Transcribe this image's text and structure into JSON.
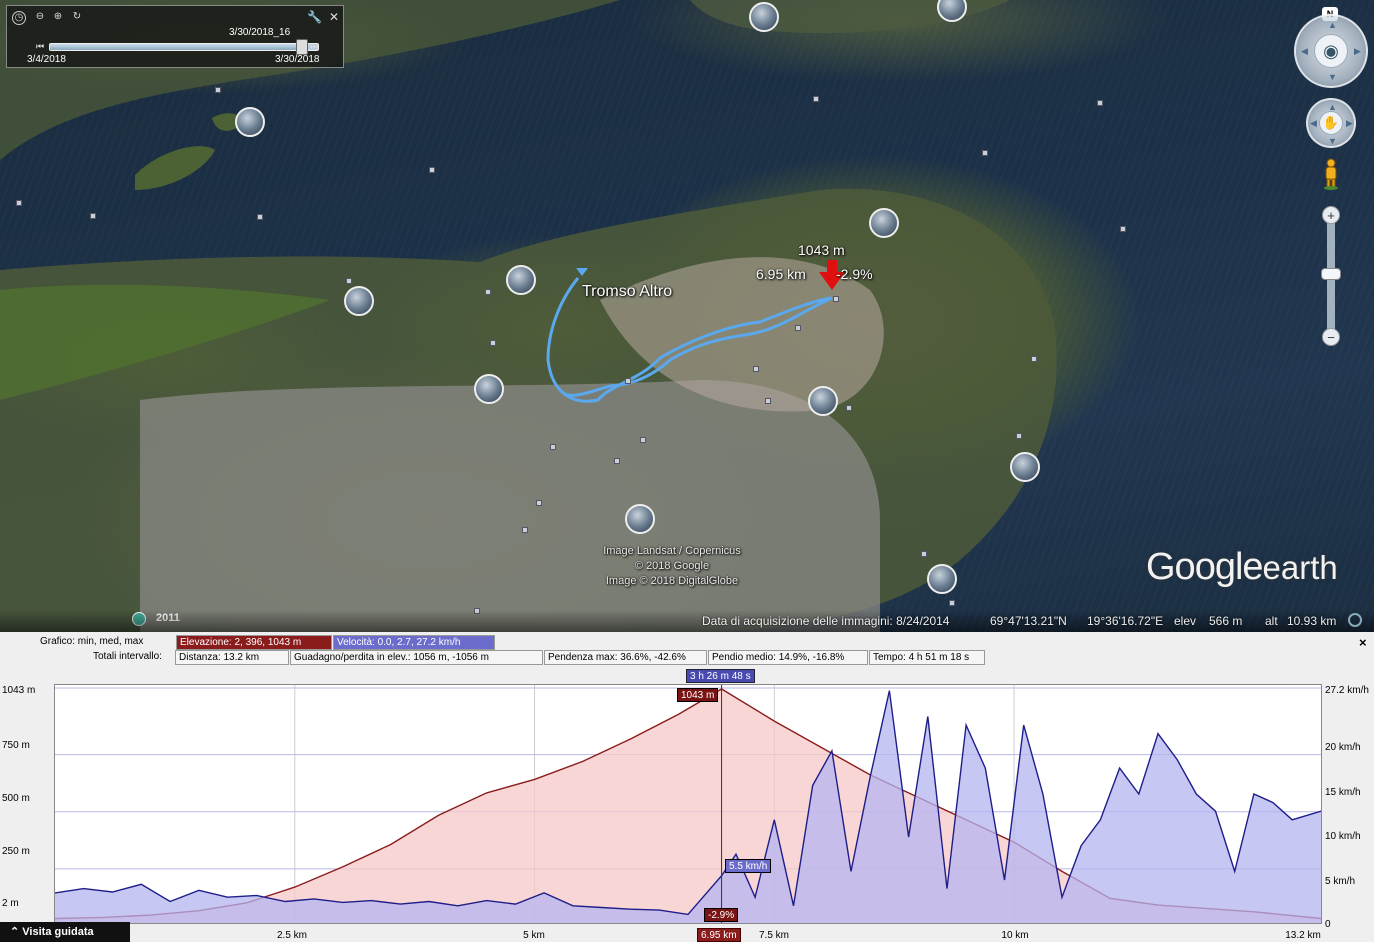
{
  "time_slider": {
    "current_label": "3/30/2018_16",
    "start_label": "3/4/2018",
    "end_label": "3/30/2018",
    "position_fraction": 0.94
  },
  "navigation": {
    "north_label": "N"
  },
  "map": {
    "place_label": "Tromso Altro",
    "hover_elevation": "1043 m",
    "hover_distance": "6.95 km",
    "hover_grade": "-2.9%",
    "credits": [
      "Image Landsat / Copernicus",
      "© 2018 Google",
      "Image © 2018 DigitalGlobe"
    ],
    "logo_main": "Google",
    "logo_sub": "earth",
    "historic_year": "2011"
  },
  "status_bar": {
    "acquisition": "Data di acquisizione delle immagini: 8/24/2014",
    "lat": "69°47'13.21\"N",
    "lon": "19°36'16.72\"E",
    "elev_label": "elev",
    "elev_value": "566 m",
    "alt_label": "alt",
    "alt_value": "10.93 km"
  },
  "profile": {
    "row1_label": "Grafico: min, med, max",
    "elevation_stat": "Elevazione: 2, 396, 1043 m",
    "speed_stat": "Velocità: 0.0, 2.7, 27.2 km/h",
    "row2_label": "Totali intervallo:",
    "distance_stat": "Distanza: 13.2 km",
    "gain_stat": "Guadagno/perdita in elev.: 1056 m, -1056 m",
    "max_grade_stat": "Pendenza max: 36.6%, -42.6%",
    "avg_grade_stat": "Pendio medio: 14.9%, -16.8%",
    "time_stat": "Tempo: 4 h 51 m 18 s",
    "close": "×",
    "cursor_time": "3 h 26 m 48 s",
    "cursor_distance": "6.95 km",
    "cursor_elev": "1043 m",
    "cursor_speed": "5.5 km/h",
    "cursor_grade": "-2.9%",
    "colors": {
      "elevation": "#8b1c1c",
      "elevation_fill": "#f7c8c8",
      "speed": "#1e1e8a",
      "speed_fill": "#b4b4f0"
    }
  },
  "chart_data": {
    "type": "area",
    "xlabel": "",
    "xlim": [
      0,
      13.2
    ],
    "x_ticks": [
      "2.5 km",
      "5 km",
      "6.95 km",
      "7.5 km",
      "10 km",
      "13.2 km"
    ],
    "y_left_ticks": [
      "1043 m",
      "750 m",
      "500 m",
      "250 m",
      "2 m"
    ],
    "y_right_ticks": [
      "27.2 km/h",
      "20 km/h",
      "15 km/h",
      "10 km/h",
      "5 km/h",
      "0"
    ],
    "ylim_left": [
      0,
      1043
    ],
    "ylim_right": [
      0,
      27.2
    ],
    "series": [
      {
        "name": "Elevazione",
        "axis": "left",
        "x": [
          0,
          0.5,
          1.0,
          1.5,
          2.0,
          2.5,
          3.0,
          3.5,
          4.0,
          4.5,
          5.0,
          5.5,
          6.0,
          6.5,
          6.95,
          7.5,
          8.0,
          8.5,
          9.0,
          9.5,
          10.0,
          10.5,
          11.0,
          11.5,
          12.0,
          12.5,
          13.2
        ],
        "y": [
          20,
          25,
          35,
          55,
          90,
          160,
          250,
          350,
          480,
          580,
          640,
          720,
          820,
          930,
          1043,
          900,
          780,
          660,
          560,
          460,
          360,
          230,
          110,
          80,
          65,
          50,
          20
        ]
      },
      {
        "name": "Velocità",
        "axis": "right",
        "x": [
          0,
          0.3,
          0.6,
          0.9,
          1.2,
          1.5,
          1.8,
          2.1,
          2.4,
          2.7,
          3.0,
          3.3,
          3.6,
          3.9,
          4.2,
          4.5,
          4.8,
          5.1,
          5.4,
          5.7,
          6.0,
          6.3,
          6.6,
          6.95,
          7.1,
          7.3,
          7.5,
          7.7,
          7.9,
          8.1,
          8.3,
          8.5,
          8.7,
          8.9,
          9.1,
          9.3,
          9.5,
          9.7,
          9.9,
          10.1,
          10.3,
          10.5,
          10.7,
          10.9,
          11.1,
          11.3,
          11.5,
          11.7,
          11.9,
          12.1,
          12.3,
          12.5,
          12.7,
          12.9,
          13.2
        ],
        "y": [
          3.5,
          4,
          3.6,
          4.5,
          2.5,
          3.8,
          3,
          3.2,
          2.5,
          2.8,
          2.4,
          2.6,
          2.2,
          2.5,
          2.0,
          2.6,
          2.2,
          3.5,
          2.0,
          1.8,
          1.6,
          1.5,
          1.0,
          5.5,
          8,
          3,
          12,
          2,
          16,
          20,
          6,
          17,
          27,
          10,
          24,
          4,
          23,
          18,
          5,
          23,
          15,
          3,
          9,
          12,
          18,
          15,
          22,
          19,
          15,
          13,
          6,
          15,
          14,
          12,
          13
        ]
      }
    ]
  },
  "guided_tour": "Visita guidata"
}
